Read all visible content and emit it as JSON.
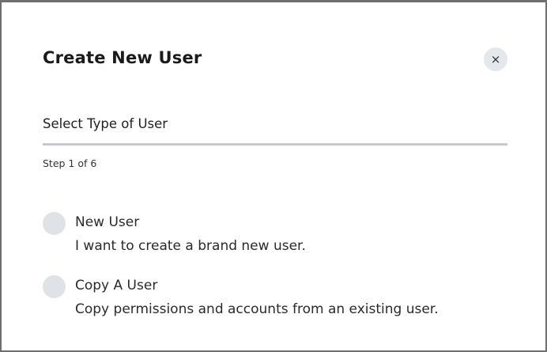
{
  "dialog": {
    "title": "Create New User",
    "close_icon": "close-icon",
    "close_glyph": "×"
  },
  "wizard": {
    "step_title": "Select Type of User",
    "step_counter": "Step 1 of 6",
    "current_step": 1,
    "total_steps": 6
  },
  "options": [
    {
      "label": "New User",
      "description": "I want to create a brand new user.",
      "selected": false
    },
    {
      "label": "Copy A User",
      "description": "Copy permissions and accounts from an existing user.",
      "selected": false
    }
  ],
  "colors": {
    "progress": "#c9c5dc",
    "radio_fill": "#dfe3e7",
    "close_bg": "#e4e8ec"
  }
}
